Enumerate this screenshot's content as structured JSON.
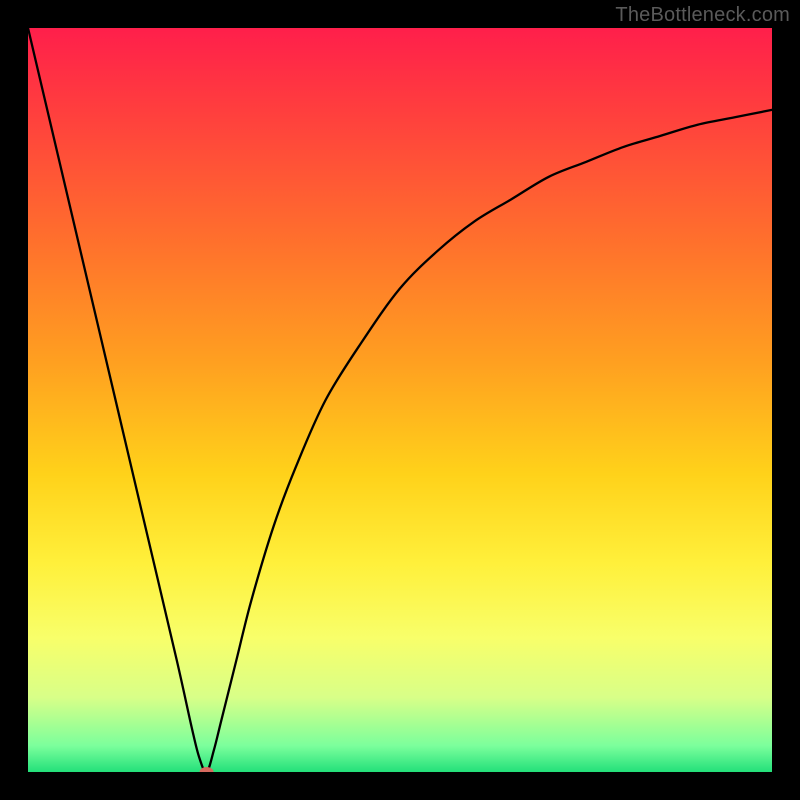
{
  "watermark": "TheBottleneck.com",
  "chart_data": {
    "type": "line",
    "title": "",
    "xlabel": "",
    "ylabel": "",
    "xlim": [
      0,
      100
    ],
    "ylim": [
      0,
      100
    ],
    "grid": false,
    "y_direction": "down_is_better",
    "notes": "Axes are unlabeled in the image. Background gradient encodes a vertical color scale from red (top / high value) through orange and yellow to green (bottom / low value). The black curve descends steeply from top-left to a minimum near x≈24, then rises on a decelerating curve toward the top-right. A small red marker sits at the curve minimum.",
    "series": [
      {
        "name": "curve",
        "x": [
          0,
          4,
          8,
          12,
          16,
          20,
          22,
          23,
          24,
          25,
          26,
          28,
          30,
          33,
          36,
          40,
          45,
          50,
          55,
          60,
          65,
          70,
          75,
          80,
          85,
          90,
          95,
          100
        ],
        "y": [
          100,
          83,
          66,
          49,
          32,
          15,
          6,
          2,
          0,
          3,
          7,
          15,
          23,
          33,
          41,
          50,
          58,
          65,
          70,
          74,
          77,
          80,
          82,
          84,
          85.5,
          87,
          88,
          89
        ]
      }
    ],
    "marker": {
      "x": 24,
      "y": 0,
      "color": "#d66a5f",
      "rx": 7,
      "ry": 5
    },
    "gradient_stops": [
      {
        "offset": 0.0,
        "color": "#ff1f4b"
      },
      {
        "offset": 0.1,
        "color": "#ff3b3f"
      },
      {
        "offset": 0.28,
        "color": "#ff6e2d"
      },
      {
        "offset": 0.45,
        "color": "#ffa020"
      },
      {
        "offset": 0.6,
        "color": "#ffd21a"
      },
      {
        "offset": 0.72,
        "color": "#fff03b"
      },
      {
        "offset": 0.82,
        "color": "#f8ff6a"
      },
      {
        "offset": 0.9,
        "color": "#d8ff88"
      },
      {
        "offset": 0.965,
        "color": "#7bff9c"
      },
      {
        "offset": 1.0,
        "color": "#23e07a"
      }
    ]
  }
}
